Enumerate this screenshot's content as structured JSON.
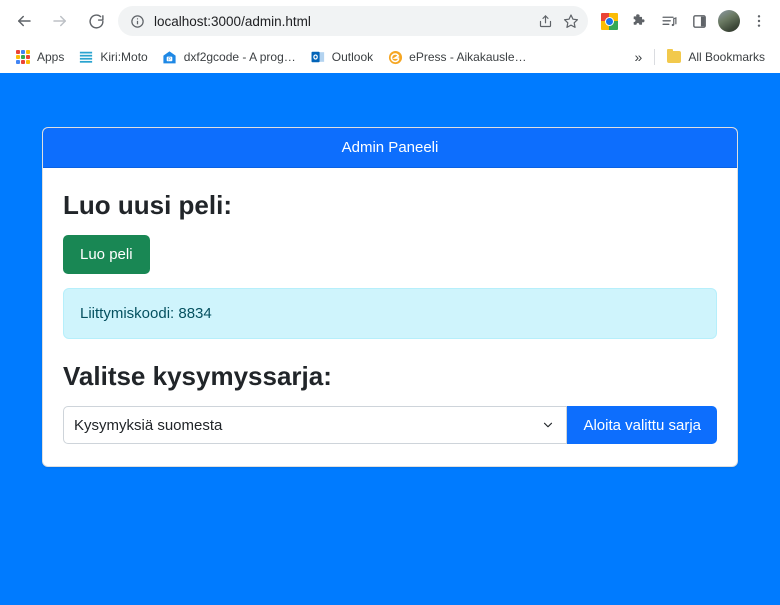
{
  "browser": {
    "nav": {
      "back_label": "Back",
      "forward_label": "Forward",
      "reload_label": "Reload"
    },
    "omnibox": {
      "url": "localhost:3000/admin.html",
      "info_icon": "site-information-icon",
      "share_icon": "share-icon",
      "bookmark_icon": "star-icon"
    },
    "toolbar_icons": [
      {
        "name": "google-extension-icon"
      },
      {
        "name": "puzzle-extensions-icon"
      },
      {
        "name": "media-playlist-icon"
      },
      {
        "name": "side-panel-icon"
      },
      {
        "name": "profile-avatar-icon"
      },
      {
        "name": "three-dot-menu-icon"
      }
    ],
    "bookmarks": {
      "items": [
        {
          "label": "Apps",
          "icon": "apps-grid-icon"
        },
        {
          "label": "Kiri:Moto",
          "icon": "kirimoto-icon"
        },
        {
          "label": "dxf2gcode - A prog…",
          "icon": "dxf2gcode-icon"
        },
        {
          "label": "Outlook",
          "icon": "outlook-icon"
        },
        {
          "label": "ePress - Aikakausle…",
          "icon": "epress-icon"
        }
      ],
      "overflow_label": "»",
      "all_bookmarks_label": "All Bookmarks",
      "all_bookmarks_icon": "folder-icon"
    }
  },
  "page": {
    "background_color": "#007bff",
    "card": {
      "header_title": "Admin Paneeli",
      "header_color": "#0d6efd",
      "create_game": {
        "title": "Luo uusi peli:",
        "button_label": "Luo peli",
        "button_color": "#198754"
      },
      "join_code_alert": {
        "text": "Liittymiskoodi: 8834",
        "background_color": "#cff4fc",
        "text_color": "#055160"
      },
      "question_set": {
        "title": "Valitse kysymyssarja:",
        "selected_option": "Kysymyksiä suomesta",
        "options": [
          "Kysymyksiä suomesta"
        ],
        "start_button_label": "Aloita valittu sarja",
        "start_button_color": "#0d6efd",
        "chevron_icon": "chevron-down-icon"
      }
    }
  }
}
